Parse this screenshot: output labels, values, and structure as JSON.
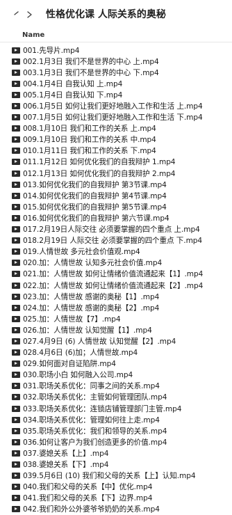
{
  "window": {
    "folder_title": "性格优化课 人际关系的奥秘"
  },
  "list": {
    "column_name": "Name",
    "files": [
      "001.先导片.mp4",
      "002.1月3日 我们不是世界的中心 上.mp4",
      "003.1月3日 我们不是世界的中心 下.mp4",
      "004.1月4日 自我认知 上.mp4",
      "005.1月4日 自我认知 下.mp4",
      "006.1月5日 如何让我们更好地融入工作和生活 上.mp4",
      "007.1月5日 如何让我们更好地融入工作和生活 下.mp4",
      "008.1月10日 我们和工作的关系 上.mp4",
      "009.1月10日 我们和工作的关系 中.mp4",
      "010.1月11日 我们和工作的关系 下.mp4",
      "011.1月12日 如何优化我们的自我辩护 1.mp4",
      "012.1月13日 如何优化我们的自我辩护 2.mp4",
      "013.如何优化我们的自我辩护 第3节课.mp4",
      "014.如何优化我们的自我辩护 第4节课.mp4",
      "015.如何优化我们的自我辩护 第5节课.mp4",
      "016.如何优化我们的自我辩护 第六节课.mp4",
      "017.2月19日人际交往 必须要掌握的四个重点 上.mp4",
      "018.2月19日 人际交往 必须要掌握的四个重点 下.mp4",
      "019.人情世故 多元社会价值观.mp4",
      "020.加：人情世故 认知多元社会价值.mp4",
      "021.加：人情世故 如何让情绪价值流通起来【1】.mp4",
      "022.加：人情世故 如何让情绪价值流通起来【2】.mp4",
      "023.加：人情世故 感谢的奥秘【1】.mp4",
      "024.加：人情世故 感谢的奥秘【2】.mp4",
      "025.加：人情世故【7】.mp4",
      "026.加：人情世故 认知觉醒【1】.mp4",
      "027.4月9日 (6) 人情世故 认知觉醒【2】.mp4",
      "028.4月6日 (6)加；人情世故.mp4",
      "029.如何面对自证陷阱.mp4",
      "030.职场小白 如何融入公司.mp4",
      "031.职场关系优化：同事之间的关系.mp4",
      "032.职场关系优化：主管如何管理团队.mp4",
      "033.职场关系优化：连锁店铺管理部门主管.mp4",
      "034.职场关系优化：管理如何往上走.mp4",
      "035.职场关系优化：我们和领导的关系.mp4",
      "036.如何让客户为我们创造更多的价值.mp4",
      "037.婆媳关系【上】.mp4",
      "038.婆媳关系【下】.mp4",
      "039.5月6日 (10) 我们和父母的关系【上】认知.mp4",
      "040.我们和父母的关系【中】优化.mp4",
      "041.我们和父母的关系【下】边界.mp4",
      "042.我们和外公外婆爷爷奶奶的关系.mp4"
    ]
  }
}
